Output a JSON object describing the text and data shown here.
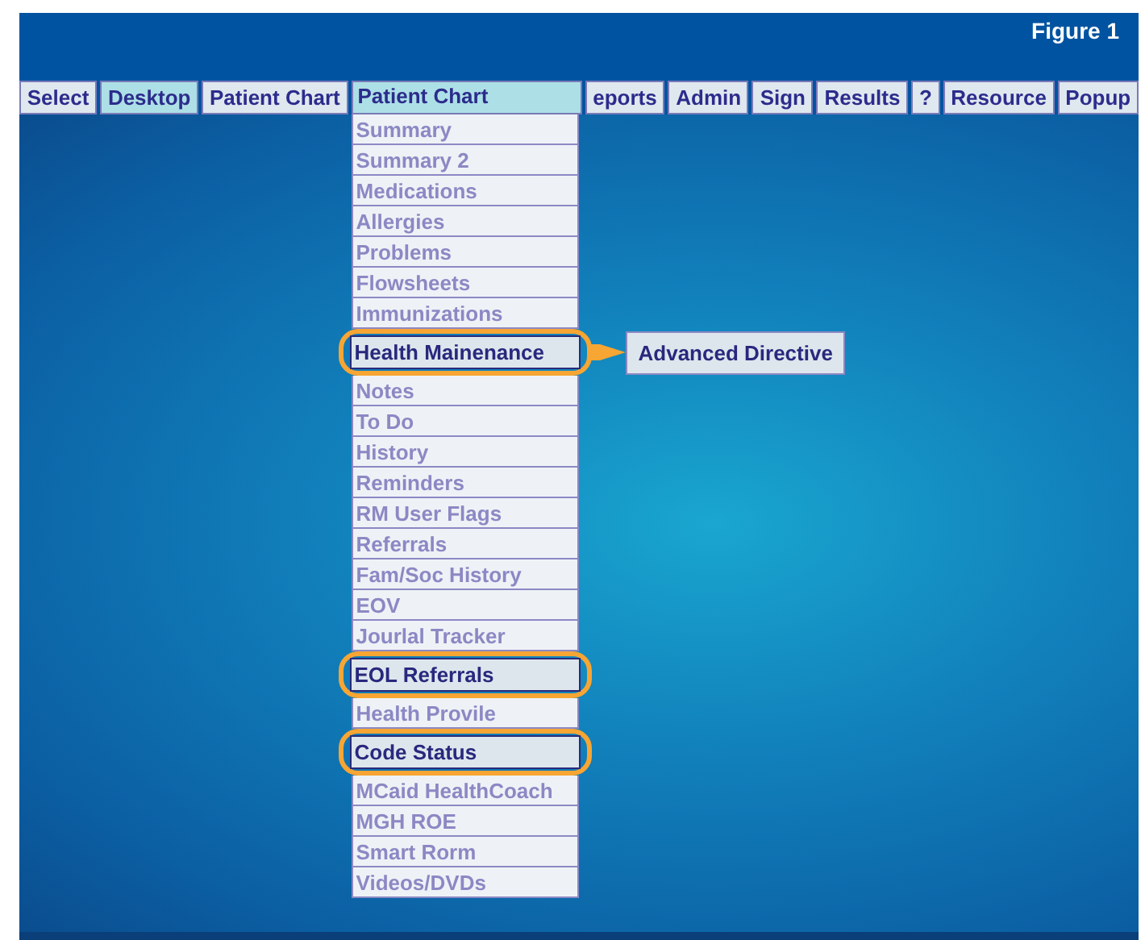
{
  "header": {
    "figure_label": "Figure 1"
  },
  "menu_bar": [
    {
      "label": "Select",
      "selected": false
    },
    {
      "label": "Desktop",
      "selected": true
    },
    {
      "label": "Patient Chart",
      "selected": false
    },
    {
      "label": "Patient Chart",
      "selected": true,
      "menu": [
        {
          "label": "Summary",
          "highlighted": false
        },
        {
          "label": "Summary 2",
          "highlighted": false
        },
        {
          "label": "Medications",
          "highlighted": false
        },
        {
          "label": "Allergies",
          "highlighted": false
        },
        {
          "label": "Problems",
          "highlighted": false
        },
        {
          "label": "Flowsheets",
          "highlighted": false
        },
        {
          "label": "Immunizations",
          "highlighted": false
        },
        {
          "label": "Health Mainenance",
          "highlighted": true,
          "submenu": [
            "Advanced Directive"
          ]
        },
        {
          "label": "Notes",
          "highlighted": false
        },
        {
          "label": "To Do",
          "highlighted": false
        },
        {
          "label": "History",
          "highlighted": false
        },
        {
          "label": "Reminders",
          "highlighted": false
        },
        {
          "label": "RM User Flags",
          "highlighted": false
        },
        {
          "label": "Referrals",
          "highlighted": false
        },
        {
          "label": "Fam/Soc History",
          "highlighted": false
        },
        {
          "label": "EOV",
          "highlighted": false
        },
        {
          "label": "Jourlal Tracker",
          "highlighted": false
        },
        {
          "label": "EOL Referrals",
          "highlighted": true
        },
        {
          "label": "Health Provile",
          "highlighted": false
        },
        {
          "label": "Code Status",
          "highlighted": true
        },
        {
          "label": "MCaid HealthCoach",
          "highlighted": false
        },
        {
          "label": "MGH ROE",
          "highlighted": false
        },
        {
          "label": "Smart Rorm",
          "highlighted": false
        },
        {
          "label": "Videos/DVDs",
          "highlighted": false
        }
      ]
    },
    {
      "label": "eports",
      "selected": false
    },
    {
      "label": "Admin",
      "selected": false
    },
    {
      "label": "Sign",
      "selected": false
    },
    {
      "label": "Results",
      "selected": false
    },
    {
      "label": "?",
      "selected": false
    },
    {
      "label": "Resource",
      "selected": false
    },
    {
      "label": "Popup",
      "selected": false
    }
  ]
}
